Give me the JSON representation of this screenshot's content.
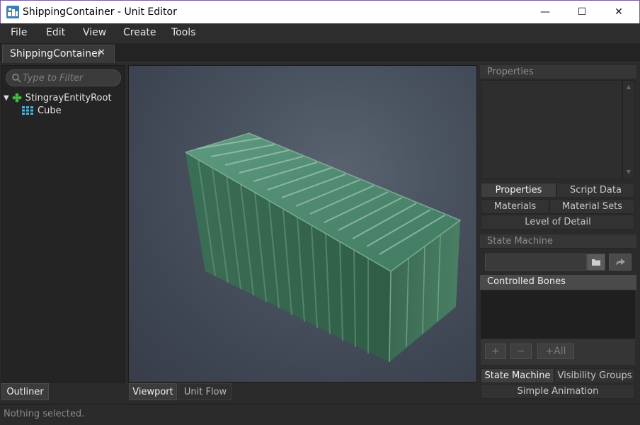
{
  "window": {
    "title": "ShippingContainer - Unit Editor",
    "min_glyph": "—",
    "max_glyph": "☐",
    "close_glyph": "✕"
  },
  "menu": {
    "items": [
      "File",
      "Edit",
      "View",
      "Create",
      "Tools"
    ]
  },
  "document_tab": {
    "label": "ShippingContainer",
    "close_glyph": "✕"
  },
  "outliner": {
    "filter_placeholder": "Type to Filter",
    "tree": {
      "root": {
        "label": "StingrayEntityRoot",
        "expanded": true,
        "icon": "entity-icon"
      },
      "children": [
        {
          "label": "Cube",
          "icon": "mesh-icon"
        }
      ]
    },
    "tab_label": "Outliner"
  },
  "viewport": {
    "tabs": [
      "Viewport",
      "Unit Flow"
    ],
    "active_tab": "Viewport"
  },
  "right_panel": {
    "properties_header": "Properties",
    "tabs_row1": [
      "Properties",
      "Script Data"
    ],
    "tabs_row2": [
      "Materials",
      "Material Sets"
    ],
    "tabs_row3": [
      "Level of Detail"
    ],
    "state_machine_header": "State Machine",
    "controlled_bones_header": "Controlled Bones",
    "bones_buttons": [
      "+",
      "−",
      "+All"
    ],
    "bottom_tabs_row1": [
      "State Machine",
      "Visibility Groups"
    ],
    "bottom_tabs_row2": [
      "Simple Animation"
    ]
  },
  "status": {
    "text": "Nothing selected."
  },
  "colors": {
    "accent_green": "#3fbf3f",
    "mesh_blue": "#4fb3d9",
    "container_green": "#3e7a5c"
  }
}
